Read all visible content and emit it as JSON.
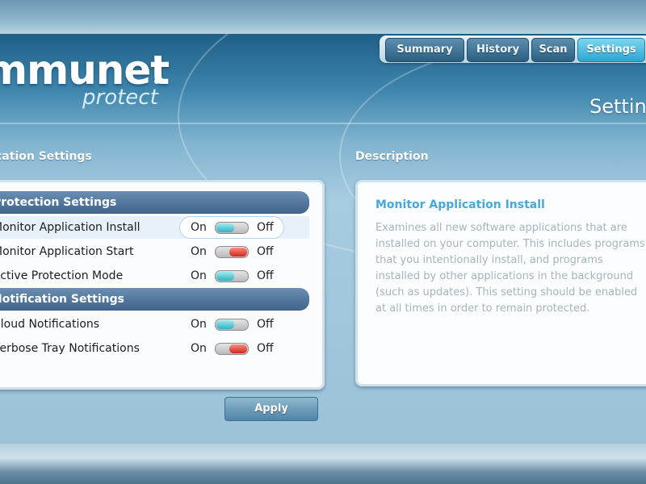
{
  "app": {
    "logo_text": "mmunet",
    "logo_subtext": "protect"
  },
  "tabs": [
    {
      "label": "Summary"
    },
    {
      "label": "History"
    },
    {
      "label": "Scan"
    },
    {
      "label": "Settings",
      "active": true
    }
  ],
  "page": {
    "title": "Settings"
  },
  "settings": {
    "heading": "cation Settings",
    "groups": [
      {
        "header": "Protection Settings",
        "rows": [
          {
            "label": "Monitor Application Install",
            "on_label": "On",
            "off_label": "Off",
            "state": "on",
            "selected": true
          },
          {
            "label": "Monitor Application Start",
            "on_label": "On",
            "off_label": "Off",
            "state": "off"
          },
          {
            "label": "Active Protection Mode",
            "on_label": "On",
            "off_label": "Off",
            "state": "on"
          }
        ]
      },
      {
        "header": "Notification Settings",
        "rows": [
          {
            "label": "Cloud Notifications",
            "on_label": "On",
            "off_label": "Off",
            "state": "on"
          },
          {
            "label": "Verbose Tray Notifications",
            "on_label": "On",
            "off_label": "Off",
            "state": "off"
          }
        ]
      }
    ],
    "apply_label": "Apply"
  },
  "description": {
    "heading": "Description",
    "title": "Monitor Application Install",
    "text": "Examines all new software applications that are installed on your computer. This includes programs that you intentionally install, and programs installed by other applications in the background (such as updates). This setting should be enabled at all times in order to remain protected."
  },
  "colors": {
    "accent": "#2aa6d3",
    "toggle_on": "#2fb2c4",
    "toggle_off": "#cc2a1e",
    "description_title": "#4aa7d6"
  }
}
